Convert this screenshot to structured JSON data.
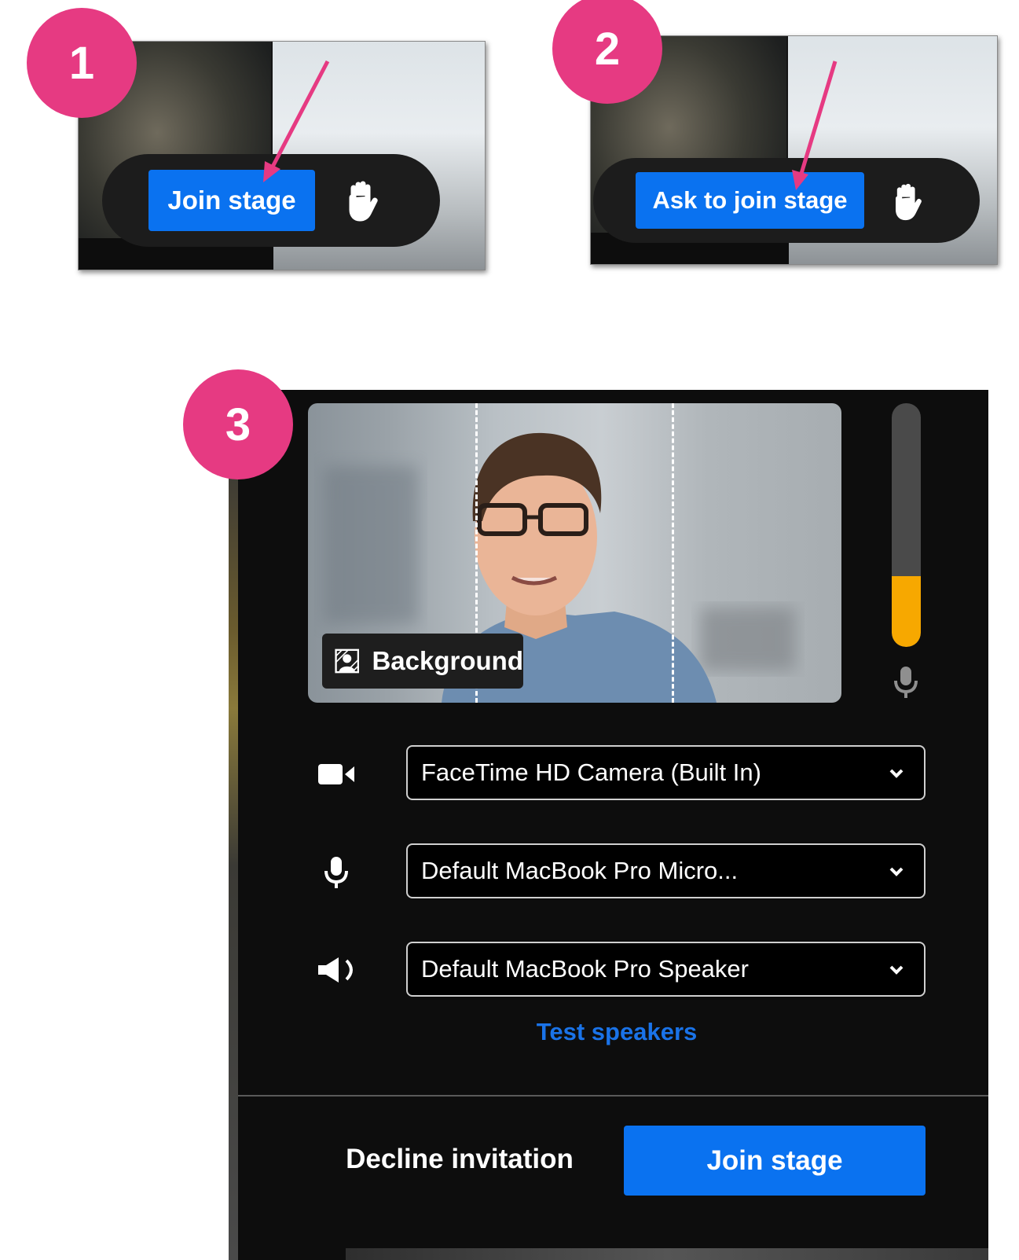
{
  "steps": [
    {
      "number": "1",
      "button_label": "Join stage"
    },
    {
      "number": "2",
      "button_label": "Ask to join stage"
    },
    {
      "number": "3"
    }
  ],
  "preview": {
    "background_label": "Background",
    "mic_level_percent": 29
  },
  "devices": {
    "camera": "FaceTime HD Camera (Built In)",
    "microphone": "Default MacBook Pro Micro...",
    "speaker": "Default MacBook Pro Speaker"
  },
  "test_speakers_label": "Test speakers",
  "footer": {
    "decline_label": "Decline invitation",
    "join_label": "Join stage"
  },
  "colors": {
    "badge": "#e63a82",
    "primary_blue": "#0a72f0",
    "link_blue": "#1a73e8",
    "meter_fill": "#f7a800",
    "arrow": "#e63a82"
  },
  "icons": [
    "hand-raise-icon",
    "background-effects-icon",
    "microphone-icon",
    "camera-icon",
    "speaker-icon",
    "chevron-down-icon"
  ]
}
